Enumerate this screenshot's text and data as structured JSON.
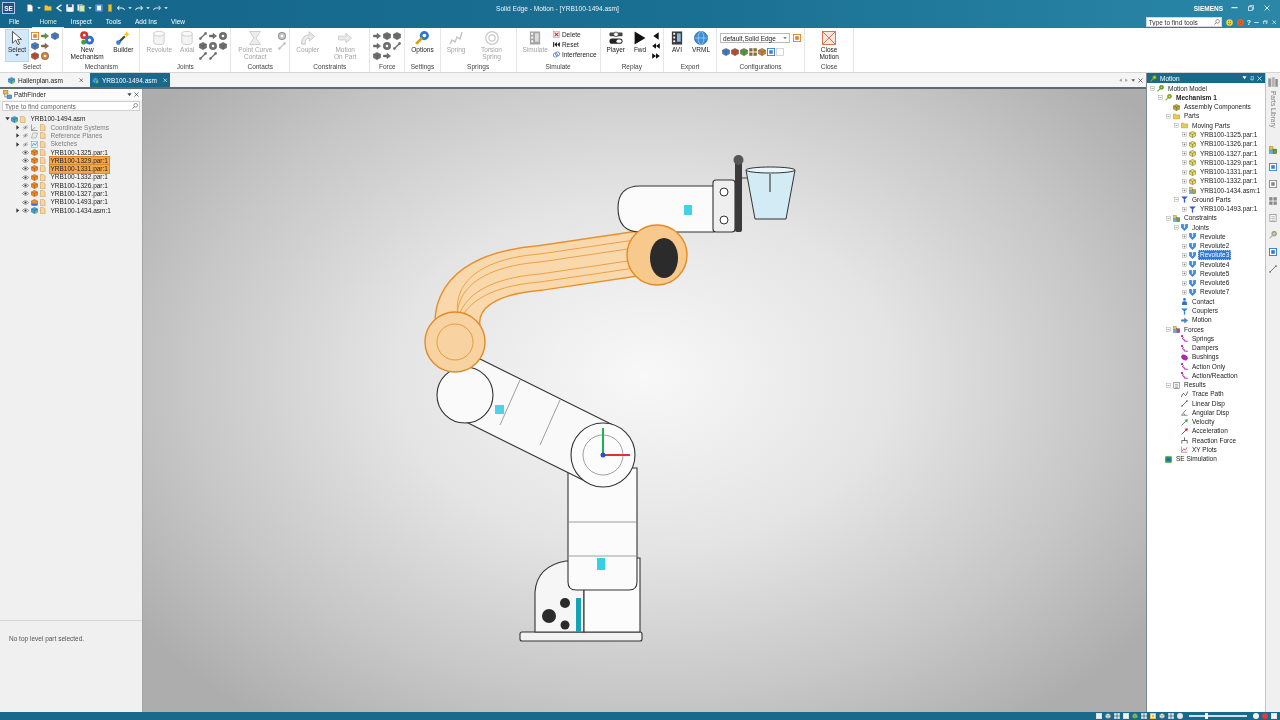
{
  "window": {
    "app_badge": "SE",
    "title": "Solid Edge - Motion - [YRB100-1494.asm]",
    "brand": "SIEMENS",
    "help": "?"
  },
  "tool_search": {
    "placeholder": "Type to find tools"
  },
  "ribbon_tabs": [
    {
      "label": "File",
      "selected": false
    },
    {
      "label": "Home",
      "selected": true
    },
    {
      "label": "Inspect",
      "selected": false
    },
    {
      "label": "Tools",
      "selected": false
    },
    {
      "label": "Add Ins",
      "selected": false
    },
    {
      "label": "View",
      "selected": false
    }
  ],
  "ribbon_groups": [
    {
      "label": "Select",
      "buttons": [
        {
          "label": "Select",
          "disabled": false,
          "pressed": true,
          "dropdown": true
        }
      ],
      "tools": [
        {
          "disabled": false
        },
        {
          "disabled": false
        },
        {
          "disabled": false
        },
        {
          "disabled": false
        },
        {
          "disabled": false
        },
        {
          "disabled": false
        },
        {
          "disabled": false
        }
      ]
    },
    {
      "label": "Mechanism",
      "buttons": [
        {
          "label": "New Mechanism",
          "disabled": false,
          "pressed": false,
          "dropdown": false
        },
        {
          "label": "Builder",
          "disabled": false,
          "pressed": false,
          "dropdown": false
        }
      ]
    },
    {
      "label": "Joints",
      "buttons": [
        {
          "label": "Revolute",
          "disabled": true,
          "pressed": false,
          "dropdown": false
        },
        {
          "label": "Axial",
          "disabled": true,
          "pressed": false,
          "dropdown": false
        }
      ],
      "tools": [
        {
          "disabled": false
        },
        {
          "disabled": false
        },
        {
          "disabled": false
        },
        {
          "disabled": false
        },
        {
          "disabled": false
        },
        {
          "disabled": false
        },
        {
          "disabled": false
        },
        {
          "disabled": false
        }
      ]
    },
    {
      "label": "Contacts",
      "buttons": [
        {
          "label": "Point Curve Contact",
          "disabled": true,
          "pressed": false,
          "dropdown": false
        }
      ],
      "tools": [
        {
          "disabled": true
        },
        {
          "disabled": true
        }
      ]
    },
    {
      "label": "Constraints",
      "buttons": [
        {
          "label": "Coupler",
          "disabled": true,
          "pressed": false,
          "dropdown": false
        },
        {
          "label": "Motion On Part",
          "disabled": true,
          "pressed": false,
          "dropdown": false
        }
      ]
    },
    {
      "label": "Force",
      "tools": [
        {
          "disabled": false
        },
        {
          "disabled": false
        },
        {
          "disabled": false
        },
        {
          "disabled": false
        },
        {
          "disabled": false
        },
        {
          "disabled": false
        },
        {
          "disabled": false
        },
        {
          "disabled": false
        }
      ]
    },
    {
      "label": "Settings",
      "buttons": [
        {
          "label": "Options",
          "disabled": false,
          "pressed": false,
          "dropdown": false
        }
      ]
    },
    {
      "label": "Springs",
      "buttons": [
        {
          "label": "Spring",
          "disabled": true,
          "pressed": false,
          "dropdown": false
        },
        {
          "label": "Torsion Spring",
          "disabled": true,
          "pressed": false,
          "dropdown": false
        }
      ]
    },
    {
      "label": "Simulate",
      "buttons": [
        {
          "label": "Simulate",
          "disabled": true,
          "pressed": false,
          "dropdown": false
        }
      ],
      "rows": [
        {
          "label": "Delete",
          "disabled": false
        },
        {
          "label": "Reset",
          "disabled": false
        },
        {
          "label": "Interference",
          "disabled": false
        }
      ]
    },
    {
      "label": "Replay",
      "buttons": [
        {
          "label": "Player",
          "disabled": false,
          "pressed": false,
          "dropdown": false
        },
        {
          "label": "Fwd",
          "disabled": false,
          "pressed": false,
          "dropdown": false
        }
      ],
      "tools": [
        {
          "disabled": false
        },
        {
          "disabled": false
        },
        {
          "disabled": false
        }
      ]
    },
    {
      "label": "Export",
      "buttons": [
        {
          "label": "AVI",
          "disabled": false,
          "pressed": false,
          "dropdown": false
        },
        {
          "label": "VRML",
          "disabled": false,
          "pressed": false,
          "dropdown": false
        }
      ]
    },
    {
      "label": "Configurations",
      "combo": {
        "value": "default,Solid Edge"
      },
      "tools": [
        {
          "disabled": false
        },
        {
          "disabled": false
        },
        {
          "disabled": false
        },
        {
          "disabled": false
        },
        {
          "disabled": false
        },
        {
          "disabled": false
        },
        {
          "disabled": false
        },
        {
          "disabled": true
        }
      ]
    },
    {
      "label": "Close",
      "buttons": [
        {
          "label": "Close Motion",
          "disabled": false,
          "pressed": false,
          "dropdown": false
        }
      ]
    }
  ],
  "document_tabs": [
    {
      "label": "Hallenplan.asm",
      "selected": false
    },
    {
      "label": "YRB100-1494.asm",
      "selected": true
    }
  ],
  "pathfinder": {
    "title": "PathFinder",
    "search": {
      "placeholder": "Type to find components"
    },
    "tree": [
      {
        "label": "YRB100-1494.asm",
        "kind": "assembly",
        "expanded": true,
        "selected": false,
        "children": [
          {
            "label": "Coordinate Systems",
            "kind": "coordinates",
            "expanded": false,
            "visible": false,
            "selected": false
          },
          {
            "label": "Reference Planes",
            "kind": "planes",
            "expanded": false,
            "visible": false,
            "selected": false
          },
          {
            "label": "Sketches",
            "kind": "sketches",
            "expanded": false,
            "visible": false,
            "selected": false
          },
          {
            "label": "YRB100-1325.par:1",
            "kind": "part",
            "visible": true,
            "selected": false
          },
          {
            "label": "YRB100-1329.par:1",
            "kind": "part",
            "visible": true,
            "selected": true
          },
          {
            "label": "YRB100-1331.par:1",
            "kind": "part",
            "visible": true,
            "selected": true
          },
          {
            "label": "YRB100-1332.par:1",
            "kind": "part",
            "visible": true,
            "selected": false
          },
          {
            "label": "YRB100-1326.par:1",
            "kind": "part",
            "visible": true,
            "selected": false
          },
          {
            "label": "YRB100-1327.par:1",
            "kind": "part",
            "visible": true,
            "selected": false
          },
          {
            "label": "YRB100-1493.par:1",
            "kind": "ground_part",
            "visible": true,
            "selected": false
          },
          {
            "label": "YRB100-1434.asm:1",
            "kind": "assembly",
            "expanded": false,
            "visible": true,
            "selected": false
          }
        ]
      }
    ],
    "status": "No top level part selected."
  },
  "motion_panel": {
    "title": "Motion",
    "tree": [
      {
        "label": "Motion Model",
        "kind": "model",
        "expanded": true,
        "selected": false,
        "children": [
          {
            "label": "Mechanism 1",
            "kind": "mechanism",
            "expanded": true,
            "selected": false,
            "active": true,
            "children": [
              {
                "label": "Assembly Components",
                "kind": "components",
                "selected": false
              },
              {
                "label": "Parts",
                "kind": "folder",
                "expanded": true,
                "selected": false,
                "children": [
                  {
                    "label": "Moving Parts",
                    "kind": "folder",
                    "expanded": true,
                    "selected": false,
                    "children": [
                      {
                        "label": "YRB100-1325.par:1",
                        "kind": "part",
                        "expanded": false,
                        "selected": false
                      },
                      {
                        "label": "YRB100-1326.par:1",
                        "kind": "part",
                        "expanded": false,
                        "selected": false
                      },
                      {
                        "label": "YRB100-1327.par:1",
                        "kind": "part",
                        "expanded": false,
                        "selected": false
                      },
                      {
                        "label": "YRB100-1329.par:1",
                        "kind": "part",
                        "expanded": false,
                        "selected": false
                      },
                      {
                        "label": "YRB100-1331.par:1",
                        "kind": "part",
                        "expanded": false,
                        "selected": false
                      },
                      {
                        "label": "YRB100-1332.par:1",
                        "kind": "part",
                        "expanded": false,
                        "selected": false
                      },
                      {
                        "label": "YRB100-1434.asm:1",
                        "kind": "assembly",
                        "expanded": false,
                        "selected": false
                      }
                    ]
                  },
                  {
                    "label": "Ground Parts",
                    "kind": "ground",
                    "expanded": true,
                    "selected": false,
                    "children": [
                      {
                        "label": "YRB100-1493.par:1",
                        "kind": "ground",
                        "expanded": false,
                        "selected": false
                      }
                    ]
                  }
                ]
              },
              {
                "label": "Constraints",
                "kind": "constraints",
                "expanded": true,
                "selected": false,
                "children": [
                  {
                    "label": "Joints",
                    "kind": "joint",
                    "expanded": true,
                    "selected": false,
                    "children": [
                      {
                        "label": "Revolute",
                        "kind": "joint",
                        "expanded": false,
                        "selected": false
                      },
                      {
                        "label": "Revolute2",
                        "kind": "joint",
                        "expanded": false,
                        "selected": false
                      },
                      {
                        "label": "Revolute3",
                        "kind": "joint",
                        "expanded": false,
                        "selected": true
                      },
                      {
                        "label": "Revolute4",
                        "kind": "joint",
                        "expanded": false,
                        "selected": false
                      },
                      {
                        "label": "Revolute5",
                        "kind": "joint",
                        "expanded": false,
                        "selected": false
                      },
                      {
                        "label": "Revolute6",
                        "kind": "joint",
                        "expanded": false,
                        "selected": false
                      },
                      {
                        "label": "Revolute7",
                        "kind": "joint",
                        "expanded": false,
                        "selected": false
                      }
                    ]
                  },
                  {
                    "label": "Contact",
                    "kind": "contact",
                    "selected": false
                  },
                  {
                    "label": "Couplers",
                    "kind": "coupler",
                    "selected": false
                  },
                  {
                    "label": "Motion",
                    "kind": "motion",
                    "selected": false
                  }
                ]
              },
              {
                "label": "Forces",
                "kind": "forces",
                "expanded": true,
                "selected": false,
                "children": [
                  {
                    "label": "Springs",
                    "kind": "spring",
                    "selected": false
                  },
                  {
                    "label": "Dampers",
                    "kind": "damper",
                    "selected": false
                  },
                  {
                    "label": "Bushings",
                    "kind": "bushing",
                    "selected": false
                  },
                  {
                    "label": "Action Only",
                    "kind": "action",
                    "selected": false
                  },
                  {
                    "label": "Action/Reaction",
                    "kind": "action",
                    "selected": false
                  }
                ]
              },
              {
                "label": "Results",
                "kind": "results",
                "expanded": true,
                "selected": false,
                "children": [
                  {
                    "label": "Trace Path",
                    "kind": "trace",
                    "selected": false
                  },
                  {
                    "label": "Linear Disp",
                    "kind": "linear",
                    "selected": false
                  },
                  {
                    "label": "Angular Disp",
                    "kind": "angular",
                    "selected": false
                  },
                  {
                    "label": "Velocity",
                    "kind": "velocity",
                    "selected": false
                  },
                  {
                    "label": "Acceleration",
                    "kind": "acceleration",
                    "selected": false
                  },
                  {
                    "label": "Reaction Force",
                    "kind": "reaction",
                    "selected": false
                  },
                  {
                    "label": "XY Plots",
                    "kind": "plot",
                    "selected": false
                  }
                ]
              }
            ]
          },
          {
            "label": "SE Simulation",
            "kind": "simulation",
            "selected": false
          }
        ]
      }
    ]
  },
  "side_strip": {
    "title": "Parts Library"
  },
  "status_bar": {
    "zoom": {
      "level": 0.3
    }
  }
}
